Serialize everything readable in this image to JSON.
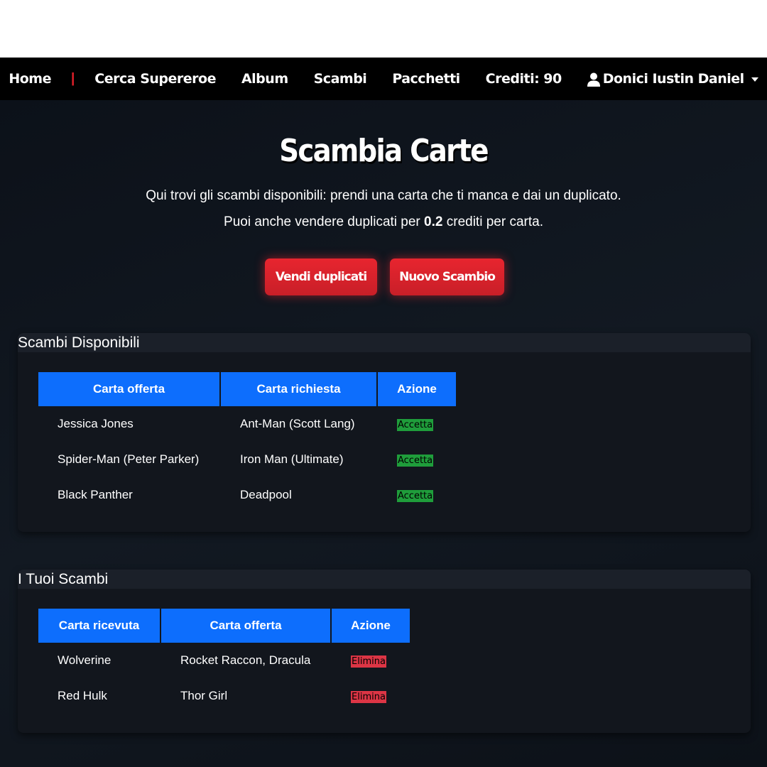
{
  "navbar": {
    "home": "Home",
    "separator": "|",
    "search": "Cerca Supereroe",
    "album": "Album",
    "trades": "Scambi",
    "packs": "Pacchetti",
    "credits": "Crediti: 90",
    "user": "Donici Iustin Daniel"
  },
  "header": {
    "title": "Scambia Carte",
    "line1": "Qui trovi gli scambi disponibili: prendi una carta che ti manca e dai un duplicato.",
    "line2_prefix": "Puoi anche vendere duplicati per ",
    "line2_bold": "0.2",
    "line2_suffix": " crediti per carta."
  },
  "buttons": {
    "sell": "Vendi duplicati",
    "new_trade": "Nuovo Scambio"
  },
  "available": {
    "title": "Scambi Disponibili",
    "columns": [
      "Carta offerta",
      "Carta richiesta",
      "Azione"
    ],
    "rows": [
      {
        "offered": "Jessica Jones",
        "requested": "Ant-Man (Scott Lang)",
        "action": "Accetta"
      },
      {
        "offered": "Spider-Man (Peter Parker)",
        "requested": "Iron Man (Ultimate)",
        "action": "Accetta"
      },
      {
        "offered": "Black Panther",
        "requested": "Deadpool",
        "action": "Accetta"
      }
    ]
  },
  "mine": {
    "title": "I Tuoi Scambi",
    "columns": [
      "Carta ricevuta",
      "Carta offerta",
      "Azione"
    ],
    "rows": [
      {
        "received": "Wolverine",
        "offered": "Rocket Raccon, Dracula",
        "action": "Elimina"
      },
      {
        "received": "Red Hulk",
        "offered": "Thor Girl",
        "action": "Elimina"
      }
    ]
  },
  "colors": {
    "accent_red": "#e3202a",
    "table_header_blue": "#0d6efd",
    "accept_green": "#1f9d3b",
    "delete_red": "#dc3545"
  }
}
